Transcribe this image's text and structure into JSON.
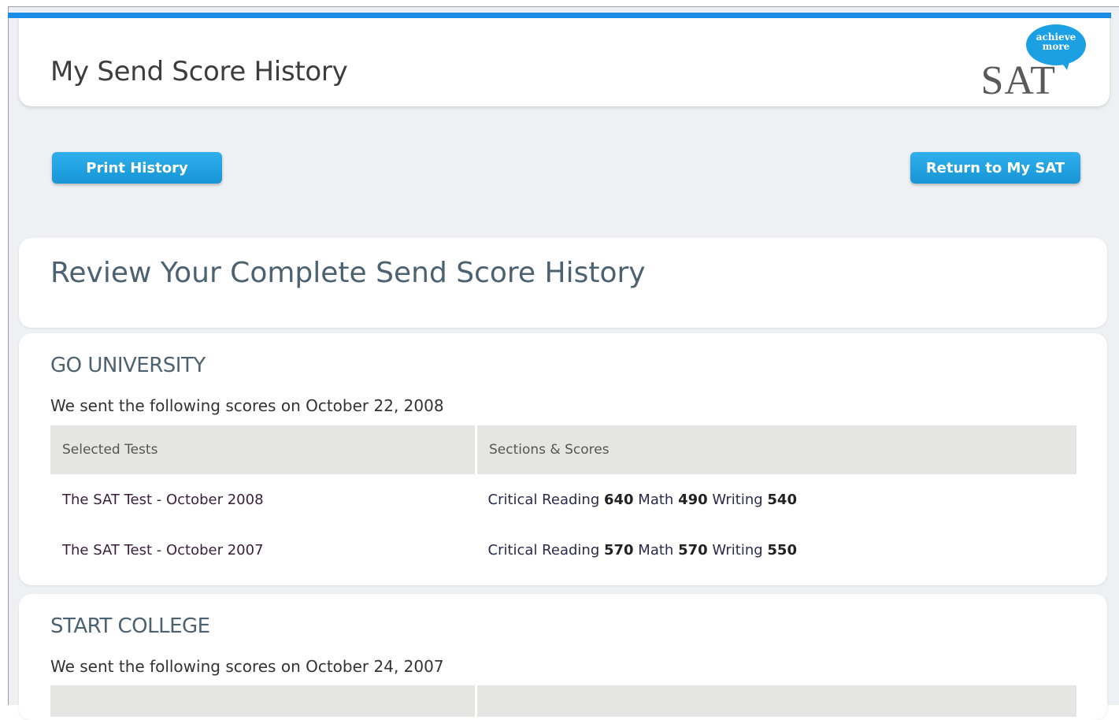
{
  "header": {
    "title": "My Send Score History",
    "logo": {
      "bubble_line1": "achieve",
      "bubble_line2": "more",
      "word": "SAT"
    }
  },
  "toolbar": {
    "print_label": "Print History",
    "return_label": "Return to My SAT"
  },
  "review": {
    "title": "Review Your Complete Send Score History"
  },
  "institutions": [
    {
      "name": "GO UNIVERSITY",
      "sent_line": "We sent the following scores on October 22, 2008",
      "columns": [
        "Selected Tests",
        "Sections & Scores"
      ],
      "rows": [
        {
          "test": "The SAT Test - October 2008",
          "sections": [
            {
              "label": "Critical Reading",
              "score": "640"
            },
            {
              "label": "Math",
              "score": "490"
            },
            {
              "label": "Writing",
              "score": "540"
            }
          ]
        },
        {
          "test": "The SAT Test - October 2007",
          "sections": [
            {
              "label": "Critical Reading",
              "score": "570"
            },
            {
              "label": "Math",
              "score": "570"
            },
            {
              "label": "Writing",
              "score": "550"
            }
          ]
        }
      ]
    },
    {
      "name": "START COLLEGE",
      "sent_line": "We sent the following scores on October 24, 2007"
    }
  ],
  "colors": {
    "accent": "#1b8de6",
    "button": "#1aa0e3",
    "heading": "#4d6270",
    "table_header": "#e5e5e3"
  }
}
